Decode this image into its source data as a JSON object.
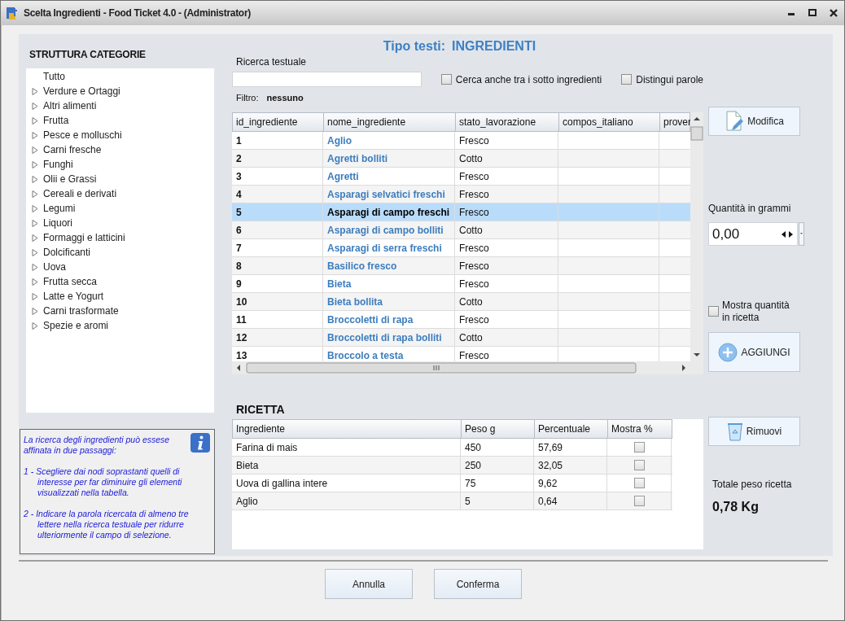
{
  "window": {
    "title": "Scelta Ingredienti - Food Ticket 4.0 - (Administrator)"
  },
  "header": {
    "label": "Tipo testi:",
    "value": "INGREDIENTI"
  },
  "categories": {
    "title": "STRUTTURA CATEGORIE",
    "items": [
      {
        "label": "Tutto",
        "expandable": false
      },
      {
        "label": "Verdure e Ortaggi",
        "expandable": true
      },
      {
        "label": "Altri alimenti",
        "expandable": true
      },
      {
        "label": "Frutta",
        "expandable": true
      },
      {
        "label": "Pesce e molluschi",
        "expandable": true
      },
      {
        "label": "Carni fresche",
        "expandable": true
      },
      {
        "label": "Funghi",
        "expandable": true
      },
      {
        "label": "Olii e Grassi",
        "expandable": true
      },
      {
        "label": "Cereali e derivati",
        "expandable": true
      },
      {
        "label": "Legumi",
        "expandable": true
      },
      {
        "label": "Liquori",
        "expandable": true
      },
      {
        "label": "Formaggi e latticini",
        "expandable": true
      },
      {
        "label": "Dolcificanti",
        "expandable": true
      },
      {
        "label": "Uova",
        "expandable": true
      },
      {
        "label": "Frutta secca",
        "expandable": true
      },
      {
        "label": "Latte e Yogurt",
        "expandable": true
      },
      {
        "label": "Carni trasformate",
        "expandable": true
      },
      {
        "label": "Spezie e aromi",
        "expandable": true
      }
    ]
  },
  "info": {
    "paragraphs": [
      {
        "kind": "text",
        "text": "La ricerca degli ingredienti può essese affinata in due passaggi:"
      },
      {
        "kind": "step",
        "text": "1 - Scegliere dai nodi soprastanti quelli di interesse per far diminuire gli elementi visualizzati nella tabella."
      },
      {
        "kind": "step",
        "text": "2 - Indicare la parola ricercata di almeno tre lettere nella ricerca testuale per ridurre ulteriormente il campo di selezione."
      }
    ]
  },
  "search": {
    "label": "Ricerca testuale",
    "options": [
      {
        "label": "Cerca anche tra i sotto ingredienti",
        "checked": false
      },
      {
        "label": "Distingui parole",
        "checked": false
      }
    ],
    "filter_label": "Filtro:",
    "filter_value": "nessuno"
  },
  "ingredients_table": {
    "columns": [
      "id_ingrediente",
      "nome_ingrediente",
      "stato_lavorazione",
      "compos_italiano",
      "prover"
    ],
    "rows": [
      {
        "id": "1",
        "name": "Aglio",
        "state": "Fresco",
        "selected": false
      },
      {
        "id": "2",
        "name": "Agretti bolliti",
        "state": "Cotto",
        "selected": false
      },
      {
        "id": "3",
        "name": "Agretti",
        "state": "Fresco",
        "selected": false
      },
      {
        "id": "4",
        "name": "Asparagi selvatici freschi",
        "state": "Fresco",
        "selected": false
      },
      {
        "id": "5",
        "name": "Asparagi di campo freschi",
        "state": "Fresco",
        "selected": true
      },
      {
        "id": "6",
        "name": "Asparagi di campo bolliti",
        "state": "Cotto",
        "selected": false
      },
      {
        "id": "7",
        "name": "Asparagi di serra freschi",
        "state": "Fresco",
        "selected": false
      },
      {
        "id": "8",
        "name": "Basilico fresco",
        "state": "Fresco",
        "selected": false
      },
      {
        "id": "9",
        "name": "Bieta",
        "state": "Fresco",
        "selected": false
      },
      {
        "id": "10",
        "name": "Bieta bollita",
        "state": "Cotto",
        "selected": false
      },
      {
        "id": "11",
        "name": "Broccoletti di rapa",
        "state": "Fresco",
        "selected": false
      },
      {
        "id": "12",
        "name": "Broccoletti di rapa bolliti",
        "state": "Cotto",
        "selected": false
      },
      {
        "id": "13",
        "name": "Broccolo a testa",
        "state": "Fresco",
        "selected": false
      }
    ]
  },
  "side": {
    "edit_button": "Modifica",
    "quantity_label": "Quantità in grammi",
    "quantity_value": "0,00",
    "show_quantity": {
      "label": "Mostra quantità in ricetta",
      "checked": false
    },
    "add_button": "AGGIUNGI",
    "remove_button": "Rimuovi",
    "total_label": "Totale peso ricetta",
    "total_value": "0,78 Kg"
  },
  "recipe": {
    "title": "RICETTA",
    "columns": [
      "Ingrediente",
      "Peso g",
      "Percentuale",
      "Mostra %"
    ],
    "rows": [
      {
        "ingredient": "Farina di mais",
        "weight": "450",
        "percent": "57,69",
        "show_percent": false
      },
      {
        "ingredient": "Bieta",
        "weight": "250",
        "percent": "32,05",
        "show_percent": false
      },
      {
        "ingredient": "Uova di gallina intere",
        "weight": "75",
        "percent": "9,62",
        "show_percent": false
      },
      {
        "ingredient": "Aglio",
        "weight": "5",
        "percent": "0,64",
        "show_percent": false
      }
    ]
  },
  "buttons": [
    "Annulla",
    "Conferma"
  ]
}
